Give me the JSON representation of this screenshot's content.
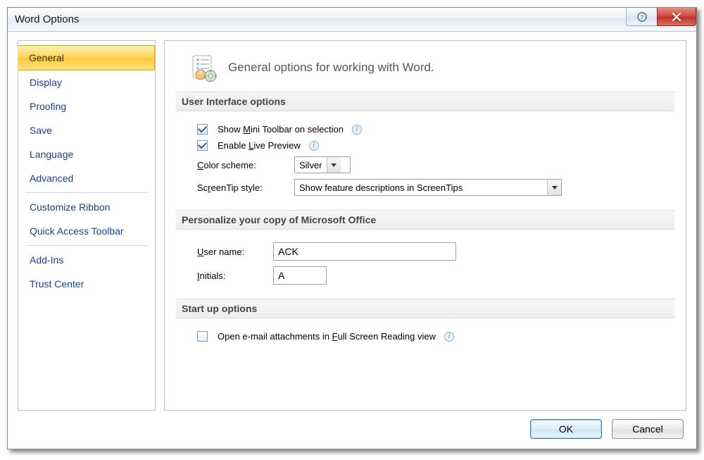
{
  "window": {
    "title": "Word Options"
  },
  "sidebar": {
    "items": [
      "General",
      "Display",
      "Proofing",
      "Save",
      "Language",
      "Advanced",
      "Customize Ribbon",
      "Quick Access Toolbar",
      "Add-Ins",
      "Trust Center"
    ],
    "selected_index": 0,
    "separator_after": [
      5,
      7
    ]
  },
  "page": {
    "header": "General options for working with Word.",
    "sections": {
      "ui": {
        "title": "User Interface options",
        "show_mini_toolbar": {
          "checked": true,
          "pre": "Show ",
          "u": "M",
          "post": "ini Toolbar on selection"
        },
        "live_preview": {
          "checked": true,
          "pre": "Enable ",
          "u": "L",
          "post": "ive Preview"
        },
        "color_scheme": {
          "pre": "",
          "u": "C",
          "post": "olor scheme:",
          "value": "Silver"
        },
        "screentip": {
          "pre": "Sc",
          "u": "r",
          "post": "eenTip style:",
          "value": "Show feature descriptions in ScreenTips"
        }
      },
      "personalize": {
        "title": "Personalize your copy of Microsoft Office",
        "user_name": {
          "pre": "",
          "u": "U",
          "post": "ser name:",
          "value": "ACK"
        },
        "initials": {
          "pre": "",
          "u": "I",
          "post": "nitials:",
          "value": "A"
        }
      },
      "startup": {
        "title": "Start up options",
        "email_attach": {
          "checked": false,
          "pre": "Open e-mail attachments in ",
          "u": "F",
          "post": "ull Screen Reading view"
        }
      }
    }
  },
  "footer": {
    "ok": "OK",
    "cancel": "Cancel"
  }
}
